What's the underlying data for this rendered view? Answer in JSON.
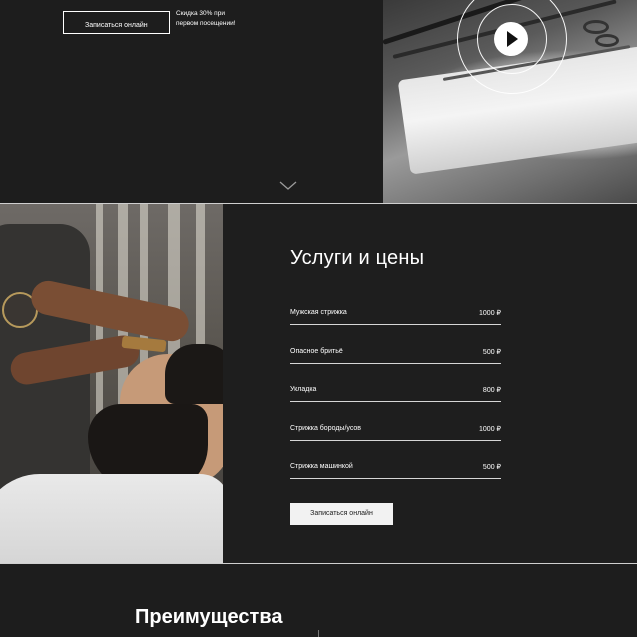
{
  "hero": {
    "book_button_label": "Записаться онлайн",
    "promo_text": "Скидка 30% при первом посещении!"
  },
  "hero_media": {
    "play_icon": "play-icon",
    "scroll_icon": "chevron-down-icon"
  },
  "services": {
    "title": "Услуги и цены",
    "items": [
      {
        "name": "Мужская стрижка",
        "price": "1000 ₽"
      },
      {
        "name": "Опасное бритьё",
        "price": "500 ₽"
      },
      {
        "name": "Укладка",
        "price": "800 ₽"
      },
      {
        "name": "Стрижка бороды/усов",
        "price": "1000 ₽"
      },
      {
        "name": "Стрижка машинкой",
        "price": "500 ₽"
      }
    ],
    "book_button_label": "Записаться онлайн"
  },
  "advantages": {
    "title": "Преимущества"
  },
  "colors": {
    "background": "#1e1e1e",
    "text": "#ffffff",
    "button_light": "#f2f2f2",
    "divider": "#d6d6d6"
  }
}
